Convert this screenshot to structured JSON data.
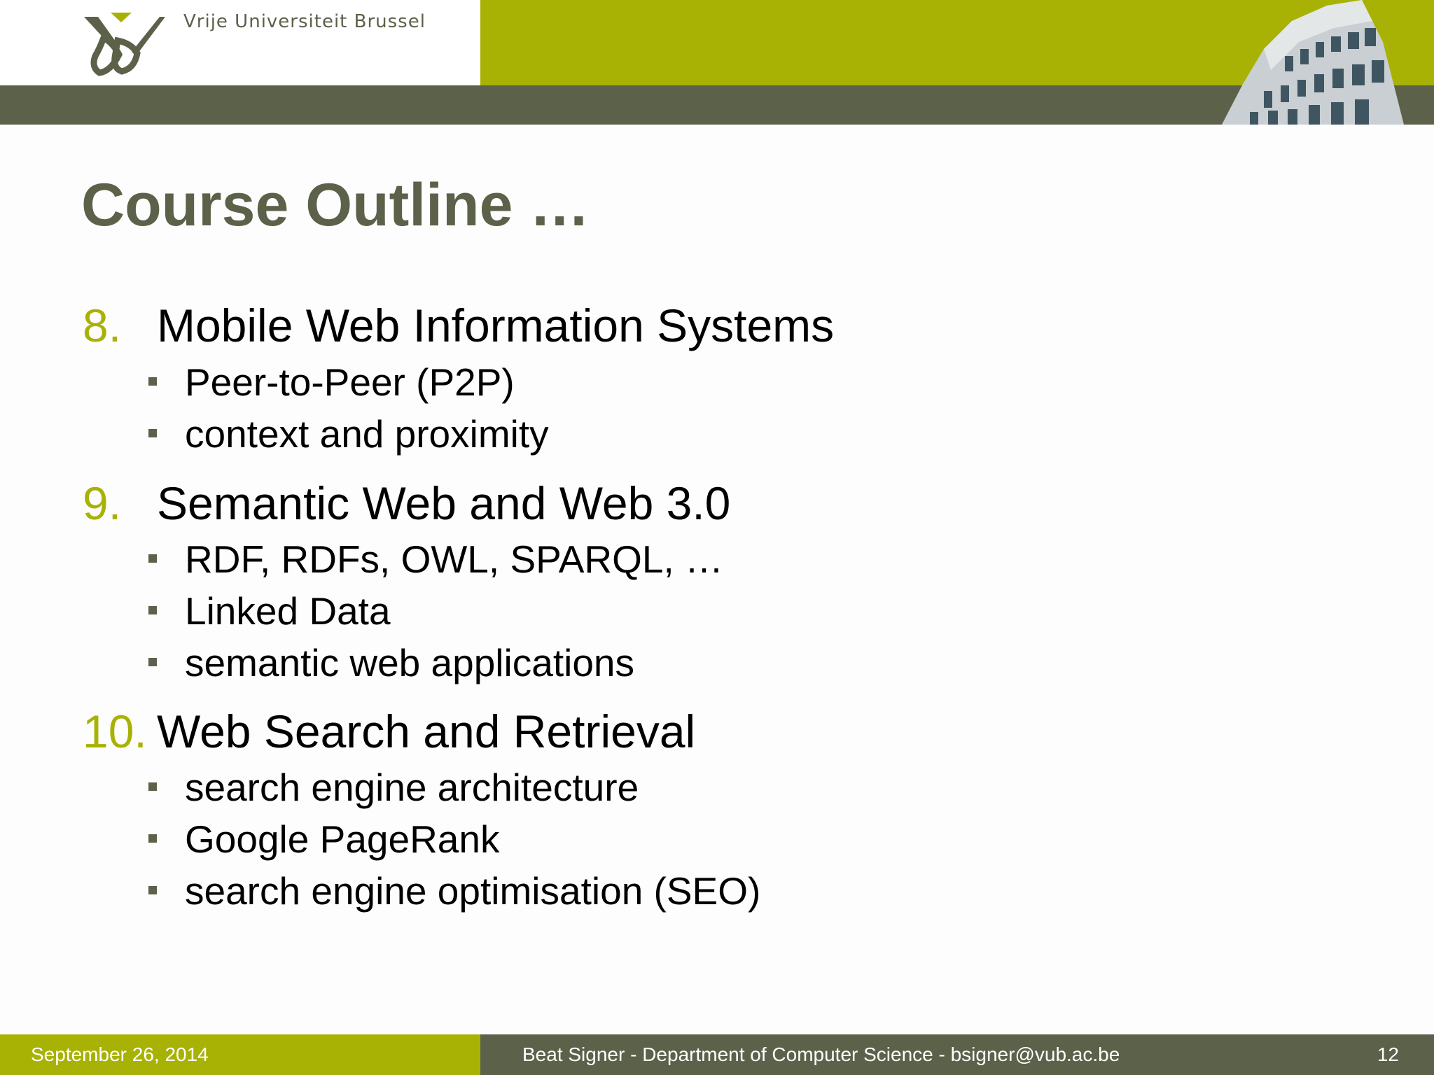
{
  "header": {
    "university": "Vrije Universiteit  Brussel",
    "logo_icon": "vub-logo-icon",
    "photo_icon": "building-photo-icon"
  },
  "slide": {
    "title": "Course Outline …",
    "items": [
      {
        "number": "8.",
        "label": "Mobile Web Information Systems",
        "subitems": [
          "Peer-to-Peer (P2P)",
          "context and proximity"
        ]
      },
      {
        "number": "9.",
        "label": "Semantic Web and Web 3.0",
        "subitems": [
          "RDF, RDFs, OWL, SPARQL, …",
          "Linked Data",
          "semantic web applications"
        ]
      },
      {
        "number": "10.",
        "label": "Web Search and Retrieval",
        "subitems": [
          "search engine architecture",
          "Google PageRank",
          "search engine optimisation (SEO)"
        ]
      }
    ]
  },
  "footer": {
    "date": "September 26, 2014",
    "author": "Beat Signer - Department of Computer Science - bsigner@vub.ac.be",
    "page": "12"
  },
  "colors": {
    "olive": "#a8b204",
    "dark_olive": "#5c614a",
    "text": "#000000"
  }
}
